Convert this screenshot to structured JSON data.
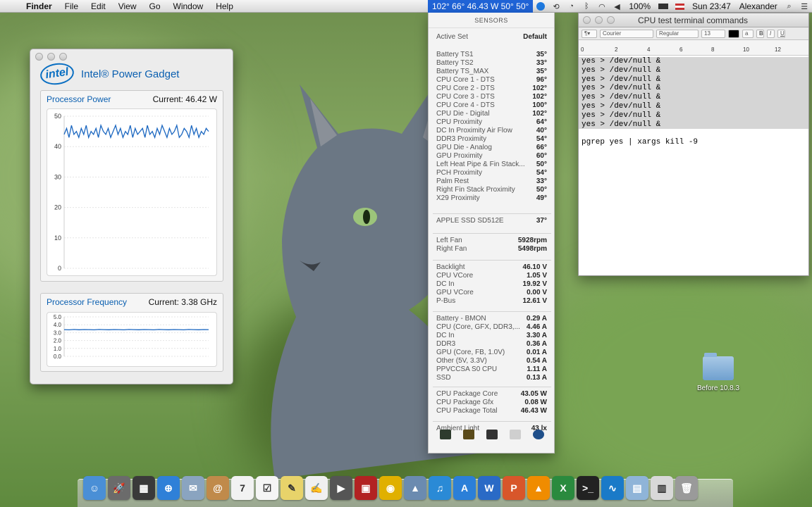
{
  "menubar": {
    "app": "Finder",
    "items": [
      "File",
      "Edit",
      "View",
      "Go",
      "Window",
      "Help"
    ],
    "sensor_readout": "102° 66° 46.43 W 50° 50°",
    "battery": "100%",
    "clock": "Sun 23:47",
    "user": "Alexander"
  },
  "power_gadget": {
    "title": "Intel® Power Gadget",
    "logo_text": "intel",
    "power": {
      "title": "Processor Power",
      "current": "Current: 46.42 W",
      "ticks": [
        "50",
        "40",
        "30",
        "20",
        "10",
        "0"
      ],
      "ylim": [
        0,
        50
      ],
      "samples": [
        44,
        46,
        43,
        47,
        44,
        45,
        43,
        46,
        44,
        47,
        43,
        45,
        44,
        46,
        43,
        47,
        45,
        44,
        46,
        43,
        45,
        47,
        44,
        46,
        43,
        45,
        44,
        47,
        43,
        46,
        44,
        45,
        46,
        43,
        47,
        44,
        45,
        43,
        46,
        44,
        47,
        45,
        43,
        46,
        44,
        45,
        47,
        43,
        44,
        46,
        45,
        43,
        47,
        44,
        46,
        43,
        45,
        44,
        46,
        45
      ]
    },
    "freq": {
      "title": "Processor Frequency",
      "current": "Current: 3.38 GHz",
      "ticks": [
        "5.0",
        "4.0",
        "3.0",
        "2.0",
        "1.0",
        "0.0"
      ],
      "ylim": [
        0,
        5
      ],
      "samples": [
        3.38,
        3.36,
        3.4,
        3.37,
        3.39,
        3.38,
        3.36,
        3.4,
        3.38,
        3.37,
        3.39,
        3.38,
        3.36,
        3.4,
        3.38,
        3.37,
        3.39,
        3.38,
        3.36,
        3.4,
        3.38,
        3.37,
        3.39,
        3.38,
        3.36,
        3.4,
        3.38,
        3.37,
        3.39,
        3.38
      ]
    }
  },
  "sensors": {
    "title": "SENSORS",
    "active_set": {
      "name": "Active Set",
      "value": "Default"
    },
    "groups": [
      [
        {
          "name": "Battery TS1",
          "value": "35°"
        },
        {
          "name": "Battery TS2",
          "value": "33°"
        },
        {
          "name": "Battery TS_MAX",
          "value": "35°"
        },
        {
          "name": "CPU Core 1 - DTS",
          "value": "96°"
        },
        {
          "name": "CPU Core 2 - DTS",
          "value": "102°"
        },
        {
          "name": "CPU Core 3 - DTS",
          "value": "102°"
        },
        {
          "name": "CPU Core 4 - DTS",
          "value": "100°"
        },
        {
          "name": "CPU Die - Digital",
          "value": "102°"
        },
        {
          "name": "CPU Proximity",
          "value": "64°"
        },
        {
          "name": "DC In Proximity Air Flow",
          "value": "40°"
        },
        {
          "name": "DDR3 Proximity",
          "value": "54°"
        },
        {
          "name": "GPU Die - Analog",
          "value": "66°"
        },
        {
          "name": "GPU Proximity",
          "value": "60°"
        },
        {
          "name": "Left Heat Pipe & Fin Stack...",
          "value": "50°"
        },
        {
          "name": "PCH Proximity",
          "value": "54°"
        },
        {
          "name": "Palm Rest",
          "value": "33°"
        },
        {
          "name": "Right Fin Stack Proximity",
          "value": "50°"
        },
        {
          "name": "X29 Proximity",
          "value": "49°"
        }
      ],
      [
        {
          "name": "APPLE SSD SD512E",
          "value": "37°"
        }
      ],
      [
        {
          "name": "Left Fan",
          "value": "5928rpm"
        },
        {
          "name": "Right Fan",
          "value": "5498rpm"
        }
      ],
      [
        {
          "name": "Backlight",
          "value": "46.10 V"
        },
        {
          "name": "CPU VCore",
          "value": "1.05 V"
        },
        {
          "name": "DC In",
          "value": "19.92 V"
        },
        {
          "name": "GPU VCore",
          "value": "0.00 V"
        },
        {
          "name": "P-Bus",
          "value": "12.61 V"
        }
      ],
      [
        {
          "name": "Battery - BMON",
          "value": "0.29 A"
        },
        {
          "name": "CPU (Core, GFX, DDR3,...",
          "value": "4.46 A"
        },
        {
          "name": "DC In",
          "value": "3.30 A"
        },
        {
          "name": "DDR3",
          "value": "0.36 A"
        },
        {
          "name": "GPU (Core, FB, 1.0V)",
          "value": "0.01 A"
        },
        {
          "name": "Other (5V, 3.3V)",
          "value": "0.54 A"
        },
        {
          "name": "PPVCCSA S0 CPU",
          "value": "1.11 A"
        },
        {
          "name": "SSD",
          "value": "0.13 A"
        }
      ],
      [
        {
          "name": "CPU Package Core",
          "value": "43.05 W"
        },
        {
          "name": "CPU Package Gfx",
          "value": "0.08 W"
        },
        {
          "name": "CPU Package Total",
          "value": "46.43 W"
        }
      ],
      [
        {
          "name": "Ambient Light",
          "value": "43 lx"
        }
      ]
    ]
  },
  "terminal": {
    "title": "CPU test terminal commands",
    "font": "Courier",
    "style": "Regular",
    "size": "13",
    "ruler": [
      "0",
      "2",
      "4",
      "6",
      "8",
      "10",
      "12"
    ],
    "selected_lines": [
      "yes > /dev/null &",
      "yes > /dev/null &",
      "yes > /dev/null &",
      "yes > /dev/null &",
      "yes > /dev/null &",
      "yes > /dev/null &",
      "yes > /dev/null &",
      "yes > /dev/null &"
    ],
    "command": "pgrep yes | xargs kill -9"
  },
  "desktop": {
    "folder_label": "Before 10.8.3"
  },
  "dock": [
    {
      "icon": "finder-icon",
      "color": "#4a8fd6",
      "glyph": "☺"
    },
    {
      "icon": "launchpad-icon",
      "color": "#6b6b6b",
      "glyph": "🚀"
    },
    {
      "icon": "mission-control-icon",
      "color": "#3a3a3a",
      "glyph": "▦"
    },
    {
      "icon": "safari-icon",
      "color": "#2f80d8",
      "glyph": "⊕"
    },
    {
      "icon": "mail-icon",
      "color": "#8aa4c0",
      "glyph": "✉"
    },
    {
      "icon": "contacts-icon",
      "color": "#c08a4a",
      "glyph": "@"
    },
    {
      "icon": "calendar-icon",
      "color": "#f2f2f2",
      "glyph": "7"
    },
    {
      "icon": "reminders-icon",
      "color": "#f5f5f5",
      "glyph": "☑"
    },
    {
      "icon": "notes-icon",
      "color": "#e8d36a",
      "glyph": "✎"
    },
    {
      "icon": "textedit-icon",
      "color": "#f0f0f0",
      "glyph": "✍"
    },
    {
      "icon": "facetime-icon",
      "color": "#555555",
      "glyph": "▶"
    },
    {
      "icon": "photo-booth-icon",
      "color": "#b22222",
      "glyph": "▣"
    },
    {
      "icon": "chrome-icon",
      "color": "#e0b000",
      "glyph": "◉"
    },
    {
      "icon": "iphoto-icon",
      "color": "#6b8bb0",
      "glyph": "▲"
    },
    {
      "icon": "itunes-icon",
      "color": "#2a8ad6",
      "glyph": "♫"
    },
    {
      "icon": "app-store-icon",
      "color": "#2b7fd8",
      "glyph": "A"
    },
    {
      "icon": "word-icon",
      "color": "#2a6ac6",
      "glyph": "W"
    },
    {
      "icon": "powerpoint-icon",
      "color": "#d8562a",
      "glyph": "P"
    },
    {
      "icon": "vlc-icon",
      "color": "#f08c00",
      "glyph": "▲"
    },
    {
      "icon": "excel-icon",
      "color": "#2a8a3e",
      "glyph": "X"
    },
    {
      "icon": "terminal-icon",
      "color": "#222222",
      "glyph": ">_"
    },
    {
      "icon": "power-gadget-icon",
      "color": "#1a7ac8",
      "glyph": "∿"
    },
    {
      "icon": "documents-folder-icon",
      "color": "#8fb4d8",
      "glyph": "▤"
    },
    {
      "icon": "downloads-folder-icon",
      "color": "#d8d8d8",
      "glyph": "▥"
    },
    {
      "icon": "trash-icon",
      "color": "#9a9a9a",
      "glyph": "🗑"
    }
  ]
}
